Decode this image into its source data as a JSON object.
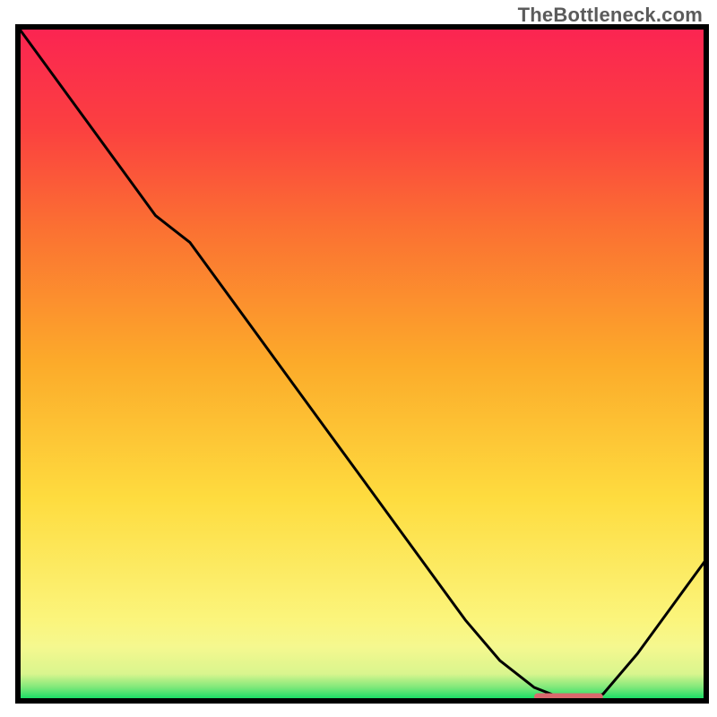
{
  "watermark": "TheBottleneck.com",
  "chart_data": {
    "type": "line",
    "title": "",
    "xlabel": "",
    "ylabel": "",
    "xlim": [
      0,
      100
    ],
    "ylim": [
      0,
      100
    ],
    "grid": false,
    "legend": false,
    "annotations": [],
    "x": [
      0,
      5,
      10,
      15,
      20,
      25,
      30,
      35,
      40,
      45,
      50,
      55,
      60,
      65,
      70,
      75,
      80,
      82,
      85,
      90,
      95,
      100
    ],
    "y": [
      100,
      93,
      86,
      79,
      72,
      68,
      61,
      54,
      47,
      40,
      33,
      26,
      19,
      12,
      6,
      2,
      0,
      0,
      1,
      7,
      14,
      21
    ],
    "marker_segment": {
      "x_start": 75,
      "x_end": 85,
      "y": 0.6
    },
    "background_gradient": {
      "stops": [
        {
          "offset": 0.0,
          "color": "#04db61"
        },
        {
          "offset": 0.02,
          "color": "#7ee87a"
        },
        {
          "offset": 0.04,
          "color": "#d9f58e"
        },
        {
          "offset": 0.08,
          "color": "#f5f88f"
        },
        {
          "offset": 0.12,
          "color": "#fbf57c"
        },
        {
          "offset": 0.3,
          "color": "#fedc3f"
        },
        {
          "offset": 0.5,
          "color": "#fcab2a"
        },
        {
          "offset": 0.7,
          "color": "#fb7132"
        },
        {
          "offset": 0.85,
          "color": "#fb4040"
        },
        {
          "offset": 1.0,
          "color": "#fb2452"
        }
      ]
    },
    "line_color": "#000000",
    "marker_color": "#d9686d"
  }
}
